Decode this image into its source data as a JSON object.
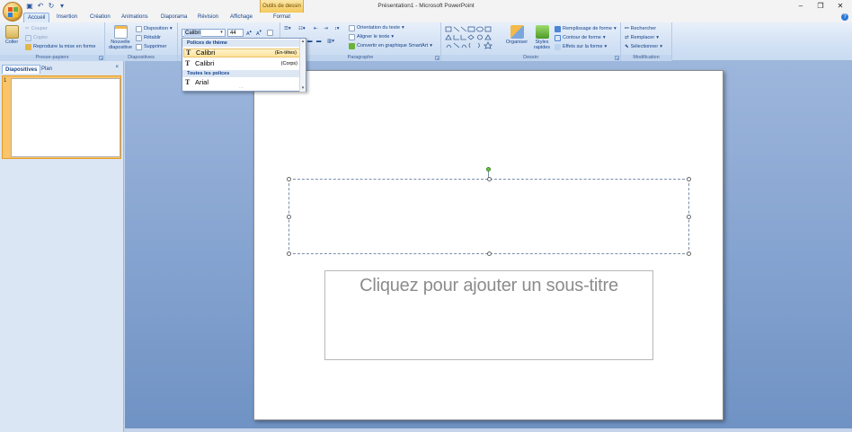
{
  "title_bar": {
    "window_title": "Présentation1 - Microsoft PowerPoint",
    "context_tab": "Outils de dessin",
    "qat": [
      "save-icon",
      "undo-icon",
      "redo-icon",
      "customize-icon"
    ],
    "controls": [
      "–",
      "❐",
      "✕"
    ]
  },
  "tabs": [
    {
      "label": "Accueil",
      "active": true
    },
    {
      "label": "Insertion"
    },
    {
      "label": "Création"
    },
    {
      "label": "Animations"
    },
    {
      "label": "Diaporama"
    },
    {
      "label": "Révision"
    },
    {
      "label": "Affichage"
    },
    {
      "label": "Format"
    }
  ],
  "ribbon": {
    "clipboard": {
      "label": "Presse-papiers",
      "paste": "Coller",
      "cut": "Couper",
      "copy": "Copier",
      "format_painter": "Reproduire la mise en forme"
    },
    "slides": {
      "label": "Diapositives",
      "new_slide": "Nouvelle diapositive",
      "layout": "Disposition",
      "reset": "Rétablir",
      "delete": "Supprimer"
    },
    "font": {
      "current_font": "Calibri",
      "current_size": "44"
    },
    "paragraph": {
      "label": "Paragraphe",
      "text_direction": "Orientation du texte",
      "align_text": "Aligner le texte",
      "smartart": "Convertir en graphique SmartArt"
    },
    "drawing": {
      "label": "Dessin",
      "arrange": "Organiser",
      "quick_styles": "Styles rapides",
      "shape_fill": "Remplissage de forme",
      "shape_outline": "Contour de forme",
      "shape_effects": "Effets sur la forme"
    },
    "editing": {
      "label": "Modification",
      "find": "Rechercher",
      "replace": "Remplacer",
      "select": "Sélectionner"
    }
  },
  "font_dropdown": {
    "theme_header": "Polices de thème",
    "theme_fonts": [
      {
        "name": "Calibri",
        "hint": "(En-têtes)",
        "selected": true
      },
      {
        "name": "Calibri",
        "hint": "(Corps)"
      }
    ],
    "all_header": "Toutes les polices",
    "all_fonts": [
      {
        "name": "Arial"
      }
    ]
  },
  "left_panel": {
    "tabs": [
      "Diapositives",
      "Plan"
    ],
    "close": "×",
    "slide_number": "1"
  },
  "slide": {
    "subtitle_placeholder": "Cliquez pour ajouter un sous-titre"
  }
}
